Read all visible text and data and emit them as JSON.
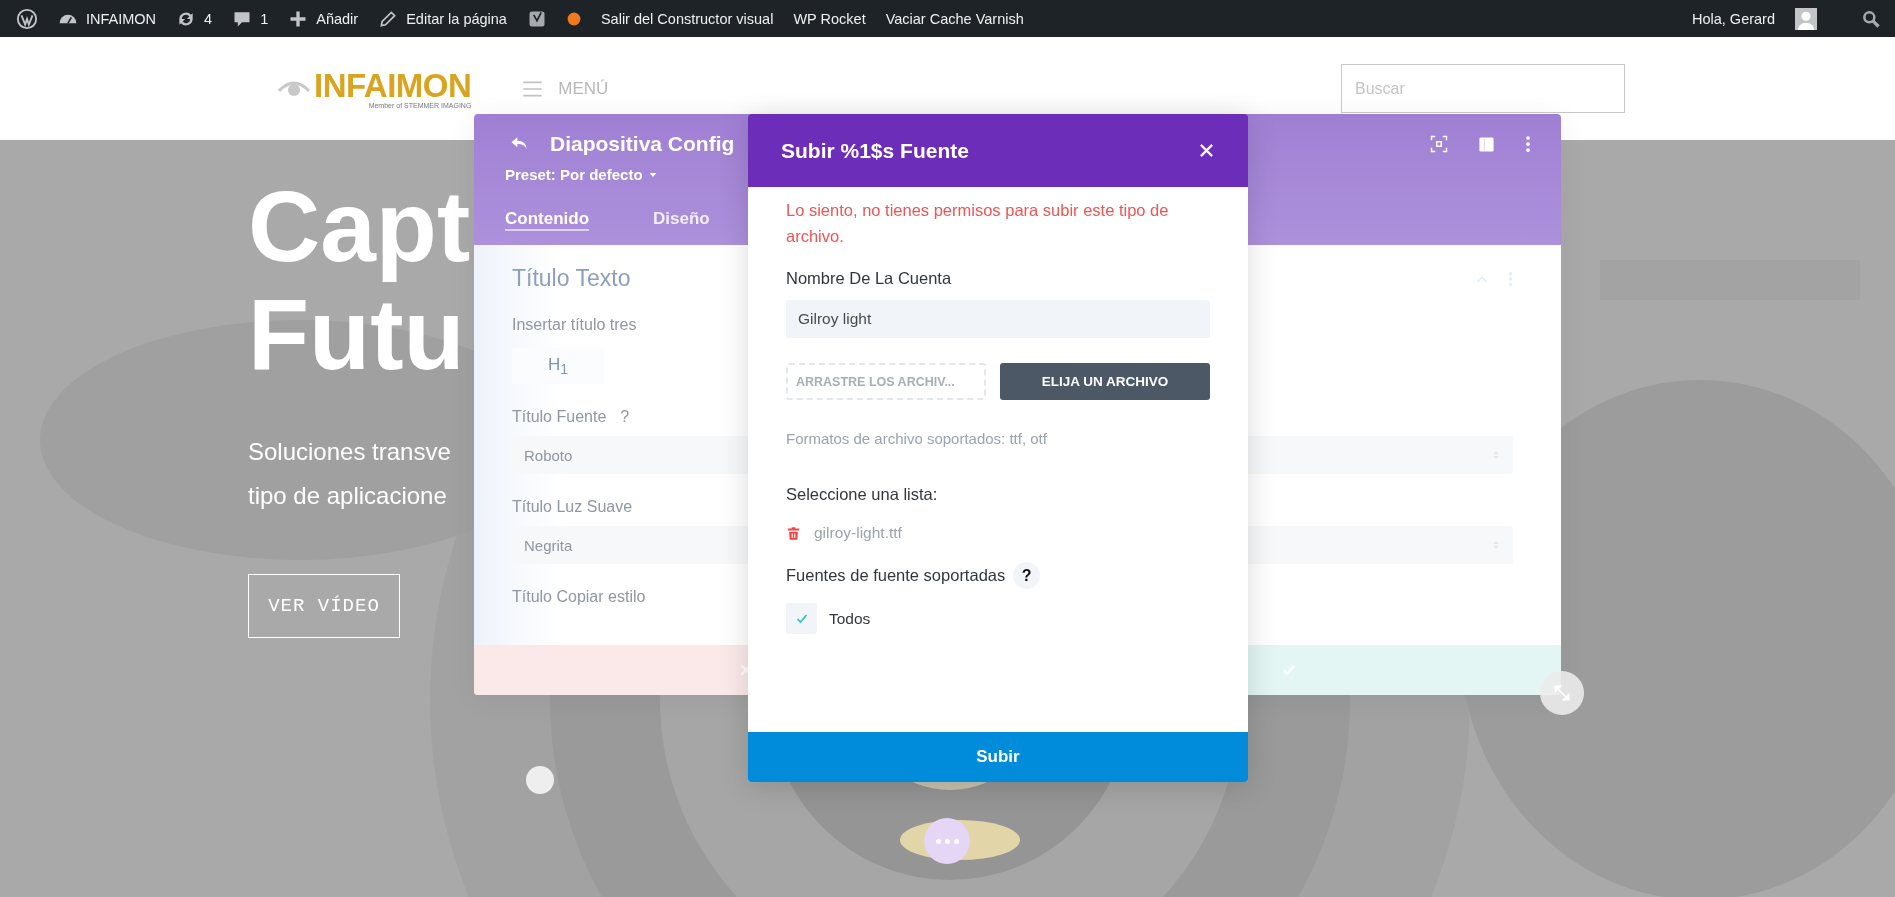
{
  "admin_bar": {
    "site": "INFAIMON",
    "updates": "4",
    "comments": "1",
    "new": "Añadir",
    "edit": "Editar la página",
    "links": [
      "Salir del Constructor visual",
      "WP Rocket",
      "Vaciar Cache Varnish"
    ],
    "greeting": "Hola, Gerard"
  },
  "header": {
    "logo": "INFAIMON",
    "logo_tagline": "Member of STEMMER IMAGING",
    "menu": "MENÚ",
    "search": {
      "placeholder": "Buscar"
    }
  },
  "hero": {
    "title_lines": [
      "Capt",
      "Futu"
    ],
    "subtitle_lines": [
      "Soluciones transve",
      "tipo de aplicacione"
    ],
    "button": "VER VÍDEO"
  },
  "settings_panel": {
    "title": "Diapositiva Config",
    "preset": "Preset: Por defecto",
    "tabs": [
      {
        "label": "Contenido",
        "selected": true
      },
      {
        "label": "Diseño",
        "selected": false
      }
    ],
    "section": "Título Texto",
    "fields": [
      {
        "kind": "heading",
        "label": "Insertar título tres",
        "value": "H$_{1}$"
      },
      {
        "kind": "select",
        "label": "Título Fuente",
        "help": "?",
        "value": "Roboto"
      },
      {
        "kind": "select",
        "label": "Título Luz Suave",
        "value": "Negrita"
      },
      {
        "kind": "label",
        "label": "Título Copiar estilo"
      }
    ]
  },
  "modal": {
    "title": "Subir %1$s Fuente",
    "error": "Lo siento, no tienes permisos para subir este tipo de archivo.",
    "name_label": "Nombre De La Cuenta",
    "name_value": "Gilroy light",
    "dropzone": "ARRASTRE LOS ARCHIV...",
    "choose_button": "ELIJA UN ARCHIVO",
    "formats": "Formatos de archivo soportados: ttf, otf",
    "list_label": "Seleccione una lista:",
    "files": [
      "gilroy-light.ttf"
    ],
    "supported_label": "Fuentes de fuente soportadas",
    "help": "?",
    "options": [
      {
        "label": "Todos",
        "checked": true
      }
    ],
    "submit": "Subir"
  }
}
